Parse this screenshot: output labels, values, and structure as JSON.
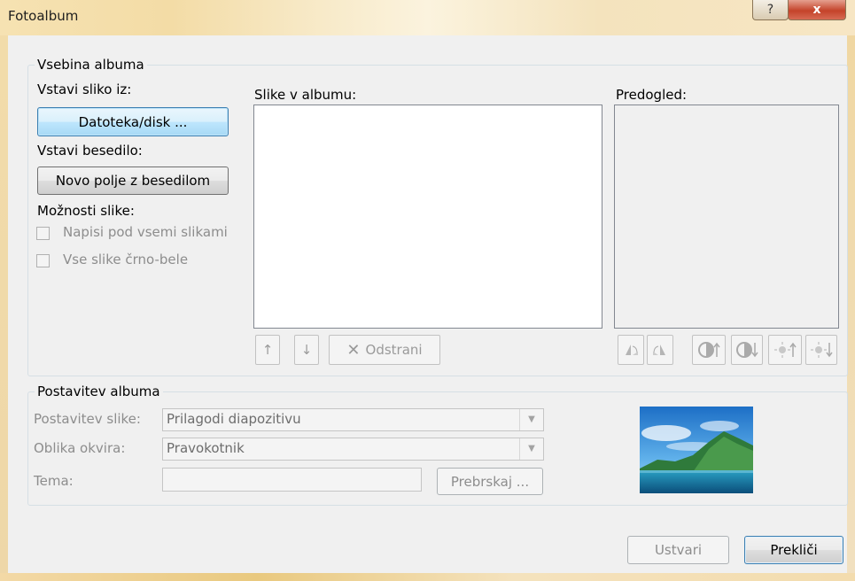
{
  "window": {
    "title": "Fotoalbum",
    "help_glyph": "?",
    "close_glyph": "x"
  },
  "content_group": {
    "legend": "Vsebina albuma",
    "insert_picture_label": "Vstavi sliko iz:",
    "file_button": "Datoteka/disk ...",
    "insert_text_label": "Vstavi besedilo:",
    "new_textbox_button": "Novo polje z besedilom",
    "picture_options_label": "Možnosti slike:",
    "captions_checkbox": "Napisi pod vsemi slikami",
    "bw_checkbox": "Vse slike črno-bele",
    "pictures_label": "Slike v albumu:",
    "preview_label": "Predogled:",
    "up_glyph": "↑",
    "down_glyph": "↓",
    "remove_glyph": "✕",
    "remove_button": "Odstrani",
    "rotate_left_icon": "rotate-left-icon",
    "rotate_right_icon": "rotate-right-icon",
    "contrast_up_icon": "contrast-up-icon",
    "contrast_down_icon": "contrast-down-icon",
    "brightness_up_icon": "brightness-up-icon",
    "brightness_down_icon": "brightness-down-icon"
  },
  "layout_group": {
    "legend": "Postavitev albuma",
    "picture_layout_label": "Postavitev slike:",
    "picture_layout_value": "Prilagodi diapozitivu",
    "frame_shape_label": "Oblika okvira:",
    "frame_shape_value": "Pravokotnik",
    "theme_label": "Tema:",
    "theme_value": "",
    "browse_button": "Prebrskaj ...",
    "dropdown_glyph": "▼"
  },
  "footer": {
    "create_button": "Ustvari",
    "cancel_button": "Prekliči"
  },
  "colors": {
    "frame": "#f3dca6",
    "dialog_bg": "#f0f0f0",
    "close_red": "#c4432a",
    "disabled_text": "#8d8d8d"
  }
}
